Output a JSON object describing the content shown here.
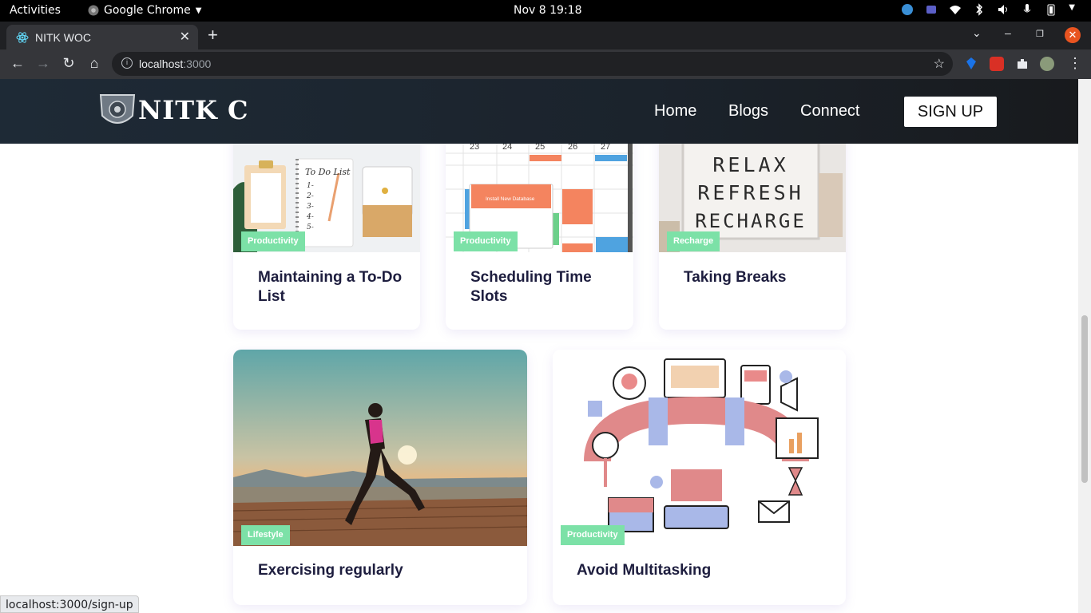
{
  "system": {
    "activities": "Activities",
    "app_name": "Google Chrome",
    "clock": "Nov 8  19:18"
  },
  "browser": {
    "tab_title": "NITK WOC",
    "url_host": "localhost",
    "url_port": ":3000",
    "status_url": "localhost:3000/sign-up"
  },
  "site": {
    "logo_text": "NITK C",
    "nav": {
      "home": "Home",
      "blogs": "Blogs",
      "connect": "Connect",
      "signup": "SIGN UP"
    }
  },
  "cards": [
    {
      "tag": "Productivity",
      "title": "Maintaining a To-Do List"
    },
    {
      "tag": "Productivity",
      "title": "Scheduling Time Slots"
    },
    {
      "tag": "Recharge",
      "title": "Taking Breaks"
    },
    {
      "tag": "Lifestyle",
      "title": "Exercising regularly"
    },
    {
      "tag": "Productivity",
      "title": "Avoid Multitasking"
    }
  ],
  "image_text": {
    "todo_heading": "To Do List",
    "todo_numbers": [
      "1-",
      "2-",
      "3-",
      "4-",
      "5-"
    ],
    "calendar_days": [
      "23",
      "24",
      "25",
      "26",
      "27"
    ],
    "calendar_popup": "Install New Database",
    "lightbox_lines": [
      "RELAX",
      "REFRESH",
      "RECHARGE"
    ]
  },
  "colors": {
    "tag_bg": "#7ce1a7",
    "title_text": "#1e1e3f",
    "nav_bg": "#1e2a36"
  }
}
